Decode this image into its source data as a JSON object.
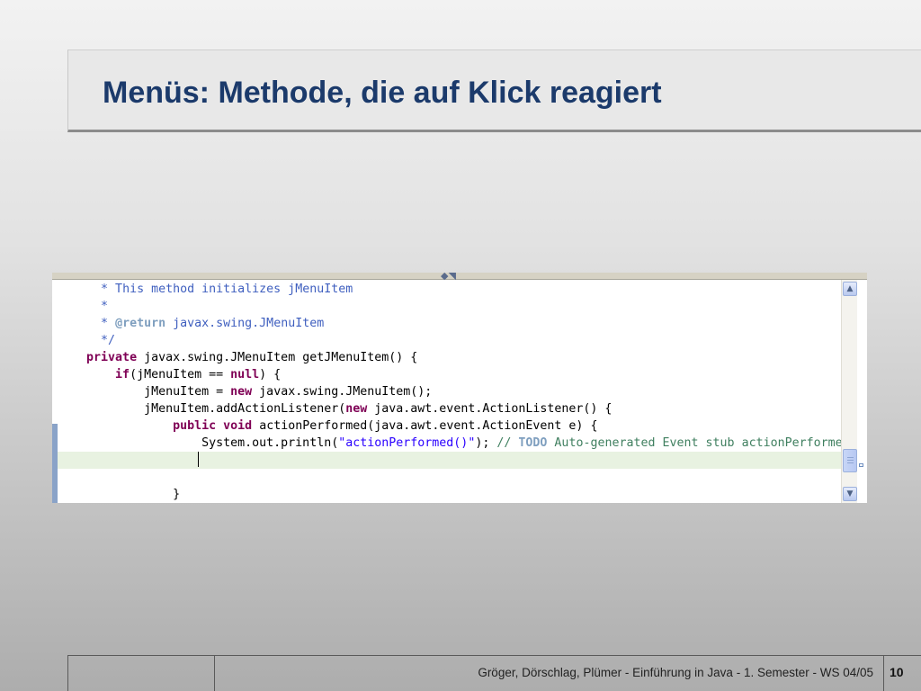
{
  "slide": {
    "title": "Menüs: Methode, die auf Klick reagiert",
    "footer_text": "Gröger, Dörschlag, Plümer -  Einführung in Java  -  1. Semester  -  WS 04/05",
    "page_number": "10"
  },
  "editor": {
    "lines": [
      [
        {
          "t": "      "
        },
        {
          "t": "* This method initializes jMenuItem",
          "c": "cm"
        }
      ],
      [
        {
          "t": "      "
        },
        {
          "t": "*",
          "c": "cm"
        }
      ],
      [
        {
          "t": "      "
        },
        {
          "t": "* ",
          "c": "cm"
        },
        {
          "t": "@return",
          "c": "tag"
        },
        {
          "t": " javax.swing.JMenuItem",
          "c": "cm"
        }
      ],
      [
        {
          "t": "      "
        },
        {
          "t": "*/",
          "c": "cm"
        }
      ],
      [
        {
          "t": "    "
        },
        {
          "t": "private",
          "c": "kw"
        },
        {
          "t": " javax.swing.JMenuItem getJMenuItem() {"
        }
      ],
      [
        {
          "t": "        "
        },
        {
          "t": "if",
          "c": "kw"
        },
        {
          "t": "(jMenuItem == "
        },
        {
          "t": "null",
          "c": "kw"
        },
        {
          "t": ") {"
        }
      ],
      [
        {
          "t": "            jMenuItem = "
        },
        {
          "t": "new",
          "c": "kw"
        },
        {
          "t": " javax.swing.JMenuItem();"
        }
      ],
      [
        {
          "t": "            jMenuItem.addActionListener("
        },
        {
          "t": "new",
          "c": "kw"
        },
        {
          "t": " java.awt.event.ActionListener() {"
        }
      ],
      [
        {
          "t": "                "
        },
        {
          "t": "public",
          "c": "kw"
        },
        {
          "t": " "
        },
        {
          "t": "void",
          "c": "kw"
        },
        {
          "t": " actionPerformed(java.awt.event.ActionEvent e) {"
        }
      ],
      [
        {
          "t": "                    System.out.println("
        },
        {
          "t": "\"actionPerformed()\"",
          "c": "str"
        },
        {
          "t": "); "
        },
        {
          "t": "// ",
          "c": "lc"
        },
        {
          "t": "TODO",
          "c": "todo"
        },
        {
          "t": " Auto-generated Event stub actionPerformed()",
          "c": "lc"
        }
      ],
      [
        {
          "t": ""
        }
      ],
      [
        {
          "t": ""
        }
      ],
      [
        {
          "t": "                }"
        }
      ]
    ],
    "current_line_index": 10,
    "scroll_up_icon": "chevron-up-icon",
    "scroll_down_icon": "chevron-down-icon"
  },
  "colors": {
    "title": "#1b3a6b",
    "keyword": "#7f0055",
    "comment": "#3f5fbf",
    "javadoc_tag": "#7f9fbf",
    "string": "#2a00ff",
    "line_comment": "#3f7f5f",
    "current_line": "#e8f2e1"
  }
}
